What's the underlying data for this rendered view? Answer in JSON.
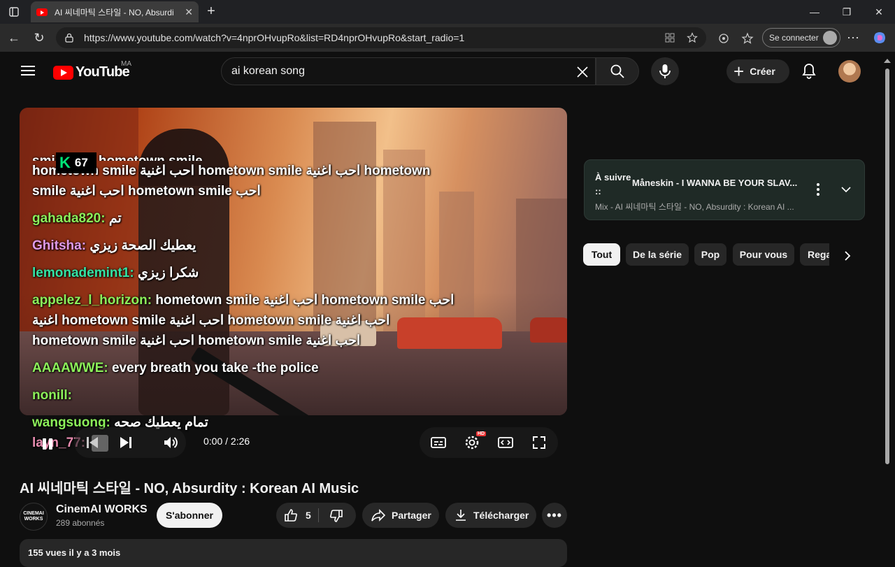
{
  "browser": {
    "tab_title": "AI 씨네마틱 스타일 - NO, Absurdi",
    "url": "https://www.youtube.com/watch?v=4nprOHvupRo&list=RD4nprOHvupRo&start_radio=1",
    "signin_label": "Se connecter"
  },
  "youtube": {
    "logo_text": "YouTube",
    "country_code": "MA",
    "search_value": "ai korean song",
    "create_label": "Créer"
  },
  "video": {
    "badge_number": "67",
    "time": "0:00 / 2:26",
    "chat": [
      {
        "user": "",
        "text": "hometown smile احب اغنية hometown smile احب اغنية hometown smile احب اغنية hometown smile احب",
        "color": "white"
      },
      {
        "user": "gahada820:",
        "text": "تم",
        "color": "green"
      },
      {
        "user": "Ghitsha:",
        "text": "يعطيك الصحة زيزي",
        "color": "pink"
      },
      {
        "user": "lemonademint1:",
        "text": "شكرا زيزي",
        "color": "teal"
      },
      {
        "user": "appelez_l_horizon:",
        "text": "hometown smile احب اغنية hometown smile احب اغنية hometown smile احب اغنية hometown smile احب اغنية hometown smile احب اغنية hometown smile احب اغنية",
        "color": "green"
      },
      {
        "user": "AAAAWWE:",
        "text": "every breath you take -the police",
        "color": "green"
      },
      {
        "user": "nonill:",
        "text": "",
        "color": "green"
      },
      {
        "user": "wangsuong:",
        "text": "تمام يعطيك صحه",
        "color": "green"
      },
      {
        "user": "layn_77:",
        "text": "",
        "color": "rose"
      }
    ]
  },
  "meta": {
    "title": "AI 씨네마틱 스타일 - NO, Absurdity : Korean AI Music",
    "channel_name": "CinemAI WORKS",
    "channel_avatar_text": "CINEMAI WORKS",
    "subscribers": "289 abonnés",
    "subscribe_label": "S'abonner",
    "likes": "5",
    "share_label": "Partager",
    "download_label": "Télécharger",
    "description_stats": "155 vues  il y a 3 mois"
  },
  "sidebar": {
    "upnext_label": "À suivre ::",
    "upnext_song": "Måneskin - I WANNA BE YOUR SLAV...",
    "mix_text": "Mix - AI 씨네마틱 스타일 - NO, Absurdity : Korean AI ...",
    "chips": [
      "Tout",
      "De la série",
      "Pop",
      "Pour vous",
      "Regardées"
    ]
  },
  "colors": {
    "brand_red": "#ff0000",
    "chat_green": "#8cf05a",
    "chat_pink": "#e09ae8",
    "chat_teal": "#34e3a4",
    "upnext_bg": "#1f2a26"
  }
}
